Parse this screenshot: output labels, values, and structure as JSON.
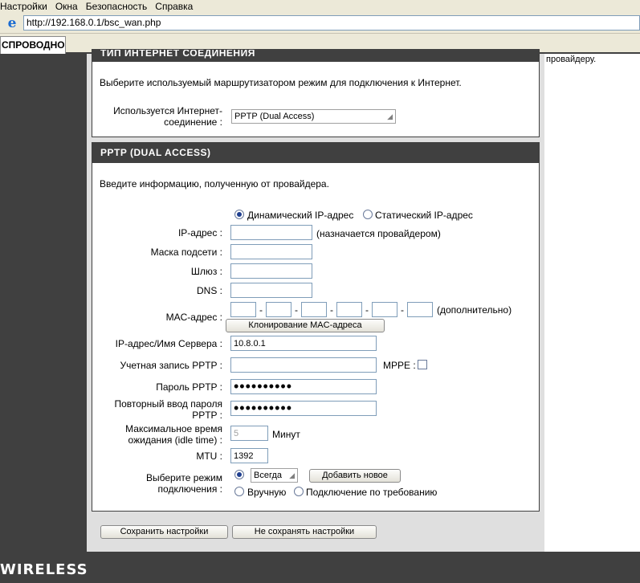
{
  "browser": {
    "menu": [
      "Настройки",
      "Окна",
      "Безопасность",
      "Справка"
    ],
    "url": "http://192.168.0.1/bsc_wan.php",
    "tab_title": "СПРОВОДНО..."
  },
  "right_panel": {
    "note": "провайдеру."
  },
  "connection_type_section": {
    "heading": "ТИП ИНТЕРНЕТ СОЕДИНЕНИЯ",
    "intro": "Выберите используемый маршрутизатором режим для подключения к Интернет.",
    "label_line1": "Используется Интернет-",
    "label_line2": "соединение :",
    "selected": "PPTP (Dual Access)"
  },
  "pptp_section": {
    "heading": "PPTP (DUAL ACCESS)",
    "intro": "Введите информацию, полученную от провайдера.",
    "address_mode": {
      "dynamic_label": "Динамический IP-адрес",
      "static_label": "Статический IP-адрес",
      "selected": "dynamic"
    },
    "ip_label": "IP-адрес :",
    "ip_value": "",
    "ip_note": "(назначается провайдером)",
    "mask_label": "Маска подсети :",
    "mask_value": "",
    "gateway_label": "Шлюз :",
    "gateway_value": "",
    "dns_label": "DNS :",
    "dns_value": "",
    "mac_label": "MAC-адрес :",
    "mac_octets": [
      "",
      "",
      "",
      "",
      "",
      ""
    ],
    "mac_separator": "-",
    "mac_note": "(дополнительно)",
    "clone_mac_button": "Клонирование MAC-адреса",
    "server_label": "IP-адрес/Имя Сервера :",
    "server_value": "10.8.0.1",
    "account_label": "Учетная запись PPTP :",
    "account_value": "",
    "mppe_label": "MPPE :",
    "mppe_checked": false,
    "password_label": "Пароль PPTP :",
    "password_value": "••••••••••",
    "confirm_label_line1": "Повторный ввод пароля",
    "confirm_label_line2": "PPTP :",
    "confirm_value": "••••••••••",
    "idle_label_line1": "Максимальное время",
    "idle_label_line2": "ожидания (idle time) :",
    "idle_value": "5",
    "idle_unit": "Минут",
    "mtu_label": "MTU :",
    "mtu_value": "1392",
    "mode_label_line1": "Выберите режим",
    "mode_label_line2": "подключения :",
    "mode_always_value": "Всегда",
    "add_new_button": "Добавить новое",
    "mode_manual_label": "Вручную",
    "mode_on_demand_label": "Подключение по требованию",
    "mode_selected": "always"
  },
  "actions": {
    "save": "Сохранить настройки",
    "dont_save": "Не сохранять настройки"
  },
  "footer": {
    "brand": "WIRELESS"
  }
}
